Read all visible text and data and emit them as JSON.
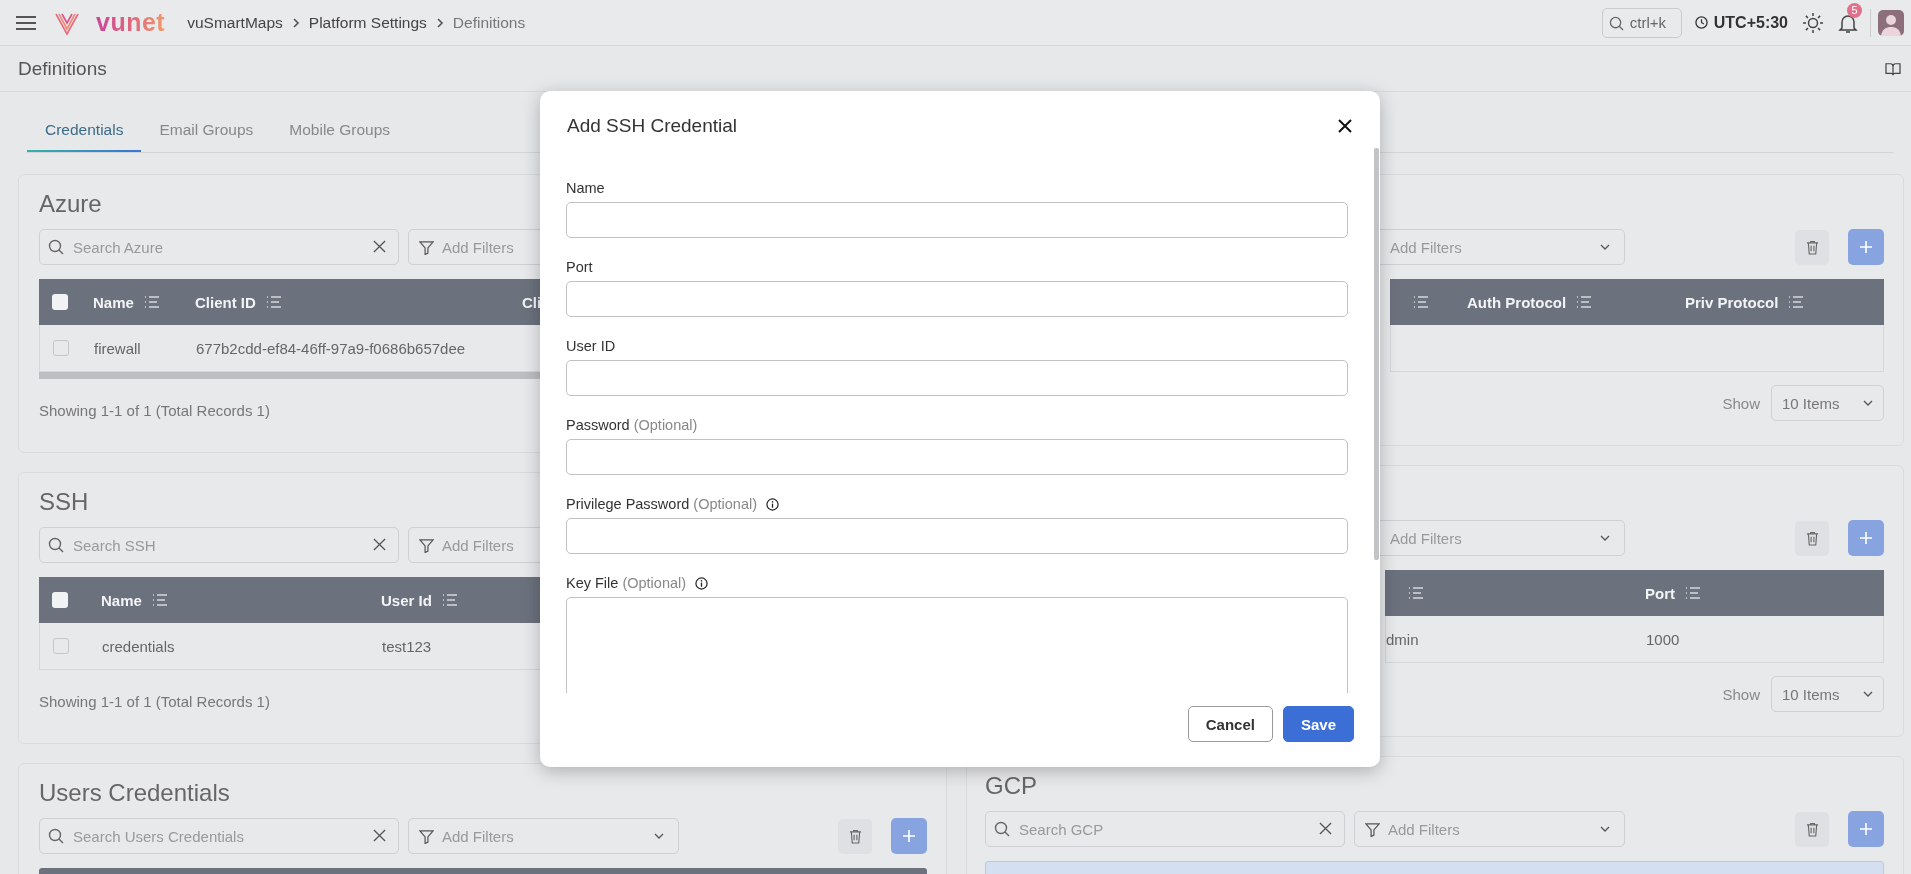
{
  "topbar": {
    "brand": "vunet",
    "breadcrumbs": [
      {
        "label": "vuSmartMaps",
        "current": false
      },
      {
        "label": "Platform Settings",
        "current": false
      },
      {
        "label": "Definitions",
        "current": true
      }
    ],
    "search_placeholder": "ctrl+k",
    "timezone": "UTC+5:30",
    "notification_count": "5"
  },
  "page_title": "Definitions",
  "tabs": [
    {
      "label": "Credentials",
      "selected": true
    },
    {
      "label": "Email Groups",
      "selected": false
    },
    {
      "label": "Mobile Groups",
      "selected": false
    }
  ],
  "left_panels": [
    {
      "title": "Azure",
      "search_placeholder": "Search Azure",
      "filter_placeholder": "Add Filters",
      "filter_icon": true,
      "actions": false,
      "all_checked": false,
      "columns": [
        {
          "label": "Name",
          "sortable": true
        },
        {
          "label": "Client ID",
          "sortable": true
        },
        {
          "label": "Cli",
          "sortable": false
        }
      ],
      "rows": [
        {
          "checked": false,
          "cells": [
            "firewall",
            "677b2cdd-ef84-46ff-97a9-f0686b657dee"
          ]
        }
      ],
      "horizontal_scrollbar": true,
      "summary": "Showing 1-1 of 1 (Total Records 1)"
    },
    {
      "title": "SSH",
      "search_placeholder": "Search SSH",
      "filter_placeholder": "Add Filters",
      "filter_icon": true,
      "actions": false,
      "all_checked": false,
      "columns": [
        {
          "label": "Name",
          "sortable": true
        },
        {
          "label": "User Id",
          "sortable": true
        }
      ],
      "rows": [
        {
          "checked": false,
          "cells": [
            "credentials",
            "test123"
          ]
        }
      ],
      "horizontal_scrollbar": false,
      "summary": "Showing 1-1 of 1 (Total Records 1)"
    },
    {
      "title": "Users Credentials",
      "search_placeholder": "Search Users Credentials",
      "filter_placeholder": "Add Filters",
      "filter_icon": true,
      "actions": true,
      "header_highlighted": false
    }
  ],
  "right_panels": [
    {
      "filter_placeholder": "Add Filters",
      "filter_icon": false,
      "actions": true,
      "columns": [
        {
          "sortable": true
        },
        {
          "label": "Auth Protocol",
          "sortable": true
        },
        {
          "label": "Priv Protocol",
          "sortable": true
        }
      ],
      "rows": [
        {}
      ],
      "horizontal_scrollbar": false,
      "show_label": "Show",
      "page_size": "10 Items"
    },
    {
      "filter_placeholder": "Add Filters",
      "filter_icon": false,
      "actions": true,
      "columns": [
        {
          "sortable": true
        },
        {
          "label": "Port",
          "sortable": true
        }
      ],
      "rows": [
        {
          "cells": [
            "dmin",
            "1000"
          ]
        }
      ],
      "horizontal_scrollbar": false,
      "show_label": "Show",
      "page_size": "10 Items"
    },
    {
      "title": "GCP",
      "search_placeholder": "Search GCP",
      "filter_placeholder": "Add Filters",
      "filter_icon": true,
      "actions": true,
      "header_highlighted": true
    }
  ],
  "dialog": {
    "title": "Add SSH Credential",
    "fields": [
      {
        "label": "Name",
        "kind": "input",
        "info": false
      },
      {
        "label": "Port",
        "kind": "input",
        "info": false
      },
      {
        "label": "User ID",
        "kind": "input",
        "info": false
      },
      {
        "label": "Password",
        "hint": "(Optional)",
        "kind": "input",
        "info": false
      },
      {
        "label": "Privilege Password",
        "hint": "(Optional)",
        "kind": "input",
        "info": true
      },
      {
        "label": "Key File",
        "hint": "(Optional)",
        "kind": "textarea",
        "info": true
      }
    ],
    "buttons": [
      {
        "label": "Cancel",
        "kind": "secondary"
      },
      {
        "label": "Save",
        "kind": "primary"
      }
    ]
  }
}
